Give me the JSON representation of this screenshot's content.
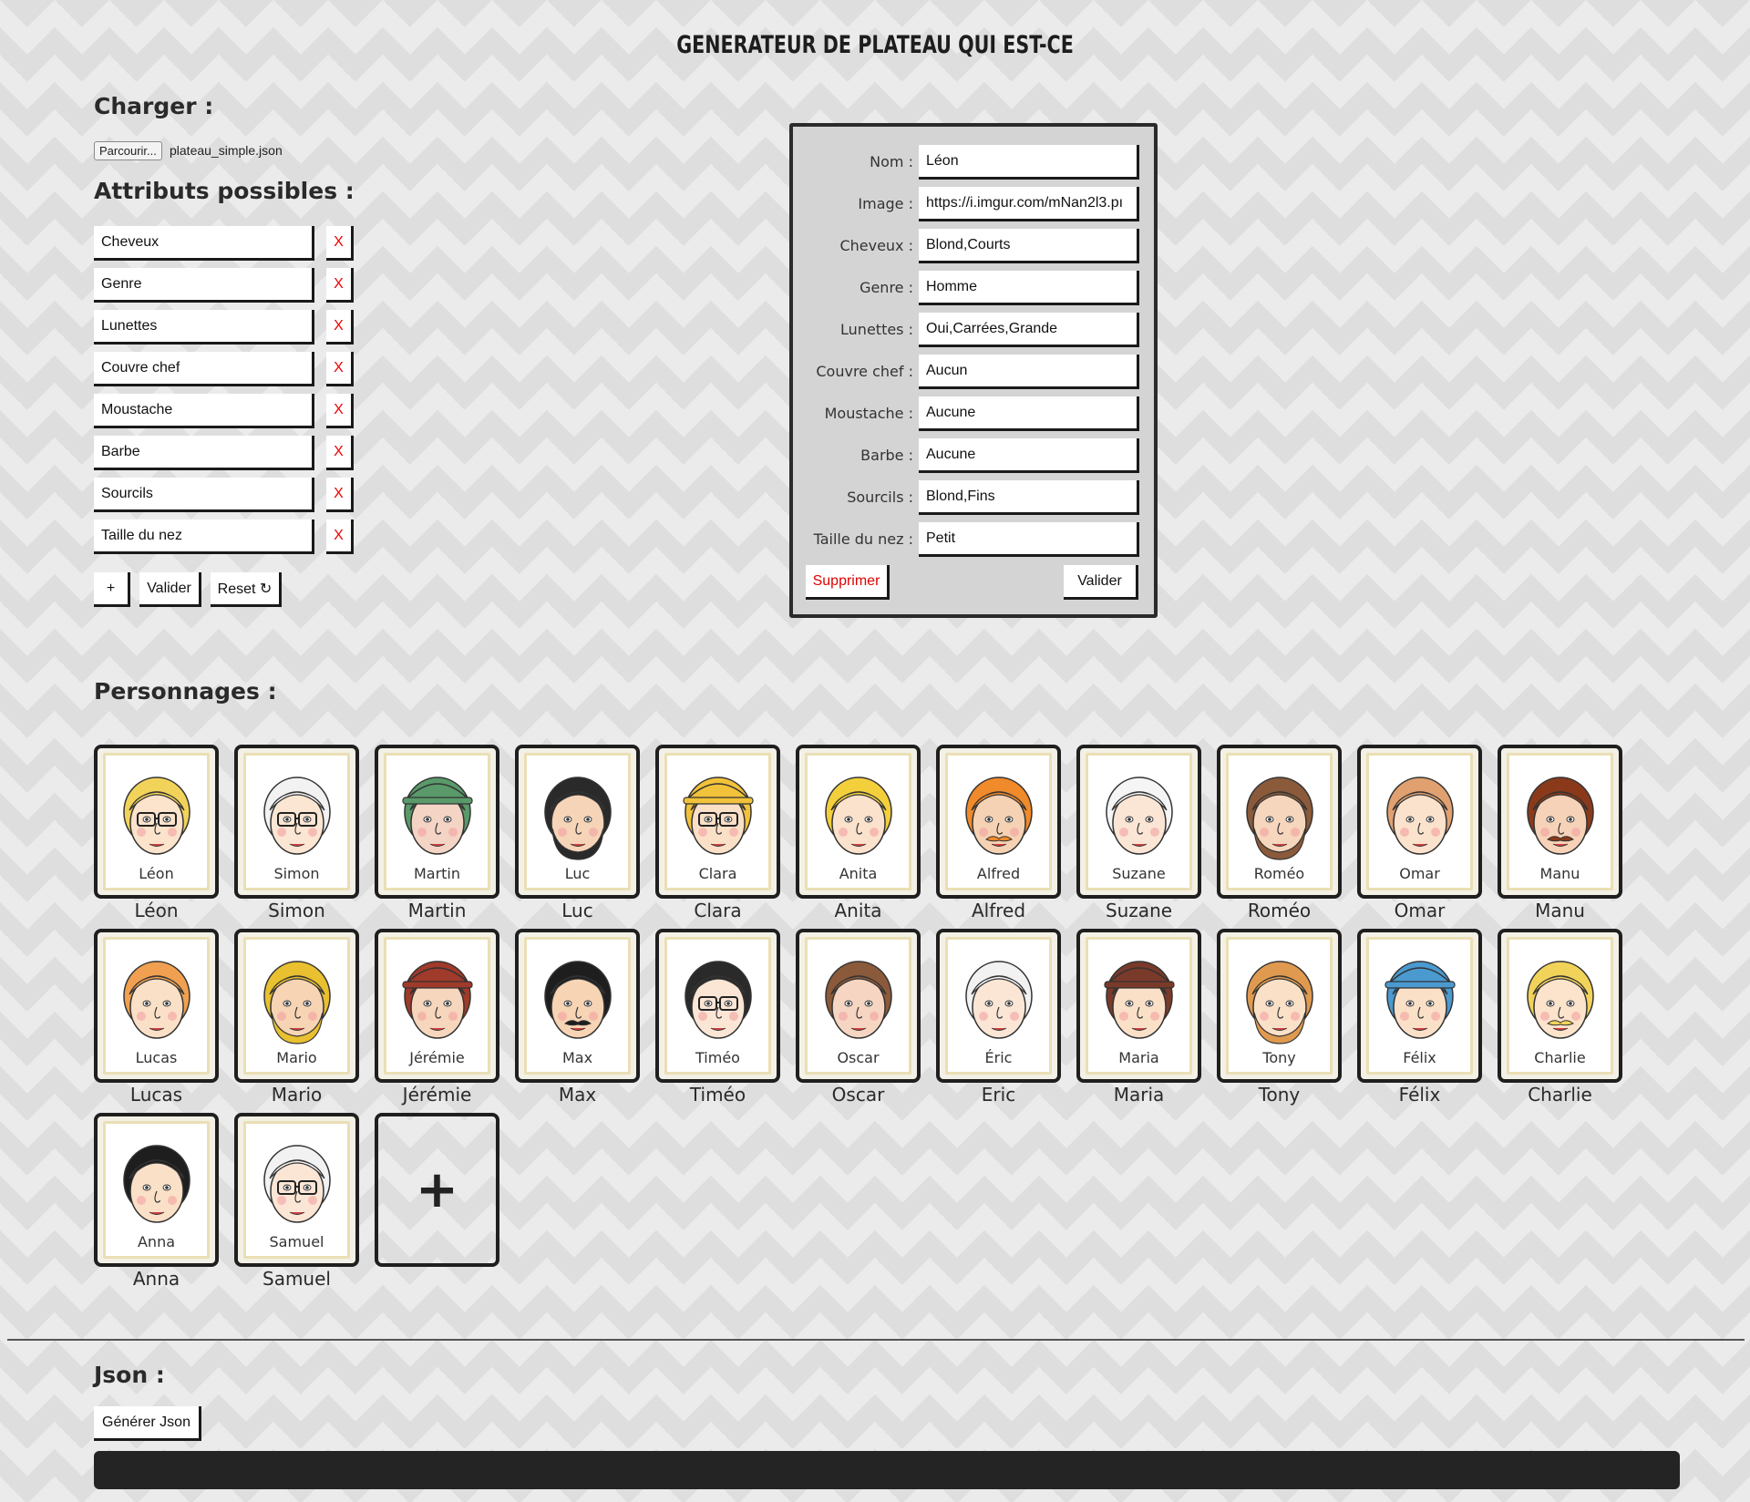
{
  "page": {
    "title": "GENERATEUR DE PLATEAU QUI EST-CE"
  },
  "charger": {
    "heading": "Charger :",
    "browse_label": "Parcourir...",
    "file_name": "plateau_simple.json"
  },
  "attributes": {
    "heading": "Attributs possibles :",
    "items": [
      "Cheveux",
      "Genre",
      "Lunettes",
      "Couvre chef",
      "Moustache",
      "Barbe",
      "Sourcils",
      "Taille du nez"
    ],
    "remove_label": "X",
    "add_label": "+",
    "validate_label": "Valider",
    "reset_label": "Reset ↻"
  },
  "editor": {
    "fields": [
      {
        "label": "Nom :",
        "value": "Léon"
      },
      {
        "label": "Image :",
        "value": "https://i.imgur.com/mNan2l3.pı"
      },
      {
        "label": "Cheveux :",
        "value": "Blond,Courts"
      },
      {
        "label": "Genre :",
        "value": "Homme"
      },
      {
        "label": "Lunettes :",
        "value": "Oui,Carrées,Grande"
      },
      {
        "label": "Couvre chef :",
        "value": "Aucun"
      },
      {
        "label": "Moustache :",
        "value": "Aucune"
      },
      {
        "label": "Barbe :",
        "value": "Aucune"
      },
      {
        "label": "Sourcils :",
        "value": "Blond,Fins"
      },
      {
        "label": "Taille du nez :",
        "value": "Petit"
      }
    ],
    "delete_label": "Supprimer",
    "validate_label": "Valider",
    "delete_color": "#e00000"
  },
  "characters": {
    "heading": "Personnages :",
    "add_label": "+",
    "list": [
      {
        "name": "Léon",
        "caption": "Léon",
        "hair": "#f2d35a",
        "skin": "#fbe3cc",
        "glasses": true,
        "icon": "face-icon"
      },
      {
        "name": "Simon",
        "caption": "Simon",
        "hair": "#f2f2f2",
        "skin": "#fbe6d3",
        "glasses": true,
        "icon": "face-icon"
      },
      {
        "name": "Martin",
        "caption": "Martin",
        "hair": "#5a9a6a",
        "skin": "#f4d4c4",
        "hat": true,
        "icon": "face-icon"
      },
      {
        "name": "Luc",
        "caption": "Luc",
        "hair": "#2a2a2a",
        "skin": "#f6d4b8",
        "beard": true,
        "icon": "face-icon"
      },
      {
        "name": "Clara",
        "caption": "Clara",
        "hair": "#f2c23a",
        "skin": "#fbe0c8",
        "glasses": true,
        "hat": true,
        "icon": "face-icon"
      },
      {
        "name": "Anita",
        "caption": "Anita",
        "hair": "#f4cf3c",
        "skin": "#fbe2cd",
        "icon": "face-icon"
      },
      {
        "name": "Alfred",
        "caption": "Alfred",
        "hair": "#f08a2a",
        "skin": "#f6d2b4",
        "mustache": true,
        "icon": "face-icon"
      },
      {
        "name": "Suzane",
        "caption": "Suzane",
        "hair": "#f5f5f5",
        "skin": "#fbe6d6",
        "icon": "face-icon"
      },
      {
        "name": "Roméo",
        "caption": "Roméo",
        "hair": "#8a5a3a",
        "skin": "#f6d6bc",
        "beard": true,
        "icon": "face-icon"
      },
      {
        "name": "Omar",
        "caption": "Omar",
        "hair": "#e0a070",
        "skin": "#fbe2cc",
        "icon": "face-icon"
      },
      {
        "name": "Manu",
        "caption": "Manu",
        "hair": "#8a3a1a",
        "skin": "#f6d2b8",
        "mustache": true,
        "icon": "face-icon"
      },
      {
        "name": "Lucas",
        "caption": "Lucas",
        "hair": "#f0a050",
        "skin": "#fbe0c8",
        "icon": "face-icon"
      },
      {
        "name": "Mario",
        "caption": "Mario",
        "hair": "#e8c030",
        "skin": "#f6d4b4",
        "beard": true,
        "icon": "face-icon"
      },
      {
        "name": "Jérémie",
        "caption": "Jérémie",
        "hair": "#a03a2a",
        "skin": "#f6d6bc",
        "hat": true,
        "icon": "face-icon"
      },
      {
        "name": "Max",
        "caption": "Max",
        "hair": "#1e1e1e",
        "skin": "#f6d4b4",
        "mustache": true,
        "icon": "face-icon"
      },
      {
        "name": "Timéo",
        "caption": "Timéo",
        "hair": "#2a2a2a",
        "skin": "#fbe6d6",
        "glasses": true,
        "icon": "face-icon"
      },
      {
        "name": "Oscar",
        "caption": "Oscar",
        "hair": "#8a5a3a",
        "skin": "#f6d6c2",
        "icon": "face-icon"
      },
      {
        "name": "Eric",
        "caption": "Éric",
        "hair": "#f2f2f2",
        "skin": "#fbe6d6",
        "icon": "face-icon"
      },
      {
        "name": "Maria",
        "caption": "Maria",
        "hair": "#7a3a2a",
        "skin": "#fbe0c8",
        "hat": true,
        "icon": "face-icon"
      },
      {
        "name": "Tony",
        "caption": "Tony",
        "hair": "#e09a50",
        "skin": "#fbe0c8",
        "beard": true,
        "icon": "face-icon"
      },
      {
        "name": "Félix",
        "caption": "Félix",
        "hair": "#4a9ad0",
        "skin": "#fbe0c8",
        "hat": true,
        "icon": "face-icon"
      },
      {
        "name": "Charlie",
        "caption": "Charlie",
        "hair": "#f2d35a",
        "skin": "#fbe3cc",
        "mustache": true,
        "icon": "face-icon"
      },
      {
        "name": "Anna",
        "caption": "Anna",
        "hair": "#1e1e1e",
        "skin": "#fbe0c8",
        "icon": "face-icon"
      },
      {
        "name": "Samuel",
        "caption": "Samuel",
        "hair": "#f2f2f2",
        "skin": "#fbe6d6",
        "glasses": true,
        "icon": "face-icon"
      }
    ]
  },
  "json_section": {
    "heading": "Json :",
    "generate_label": "Générer Json"
  }
}
